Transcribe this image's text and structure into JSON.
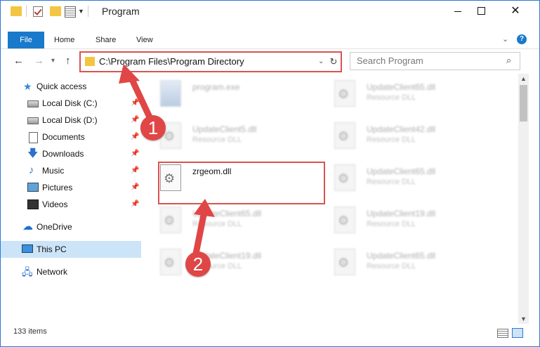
{
  "window": {
    "title": "Program",
    "controls": {
      "minimize": "",
      "maximize": "",
      "close": "✕"
    }
  },
  "ribbon": {
    "tabs": [
      "File",
      "Home",
      "Share",
      "View"
    ],
    "help": "?"
  },
  "address_bar": {
    "path": "C:\\Program Files\\Program Directory",
    "search_placeholder": "Search Program"
  },
  "sidebar": {
    "items": [
      {
        "label": "Quick access",
        "icon": "star-icon"
      },
      {
        "label": "Local Disk (C:)",
        "icon": "drive-icon",
        "pinned": true
      },
      {
        "label": "Local Disk (D:)",
        "icon": "drive-icon",
        "pinned": true
      },
      {
        "label": "Documents",
        "icon": "document-icon",
        "pinned": true
      },
      {
        "label": "Downloads",
        "icon": "download-icon",
        "pinned": true
      },
      {
        "label": "Music",
        "icon": "music-icon",
        "pinned": true
      },
      {
        "label": "Pictures",
        "icon": "pictures-icon",
        "pinned": true
      },
      {
        "label": "Videos",
        "icon": "videos-icon",
        "pinned": true
      },
      {
        "label": "OneDrive",
        "icon": "cloud-icon"
      },
      {
        "label": "This PC",
        "icon": "pc-icon",
        "selected": true
      },
      {
        "label": "Network",
        "icon": "network-icon"
      }
    ]
  },
  "files": [
    {
      "name": "program.exe",
      "type": ""
    },
    {
      "name": "UpdateClient65.dll",
      "type": "Resource DLL"
    },
    {
      "name": "UpdateClient5.dll",
      "type": "Resource DLL"
    },
    {
      "name": "UpdateClient42.dll",
      "type": "Resource DLL"
    },
    {
      "name": "zrgeom.dll",
      "type": ""
    },
    {
      "name": "UpdateClient65.dll",
      "type": "Resource DLL"
    },
    {
      "name": "UpdateClient65.dll",
      "type": "Resource DLL"
    },
    {
      "name": "UpdateClient19.dll",
      "type": "Resource DLL"
    },
    {
      "name": "UpdateClient19.dll",
      "type": "Resource DLL"
    },
    {
      "name": "UpdateClient65.dll",
      "type": "Resource DLL"
    }
  ],
  "annotations": {
    "marker1": "1",
    "marker2": "2"
  },
  "status": {
    "item_count": "133 items"
  },
  "colors": {
    "accent": "#1979ca",
    "highlight": "#d9534f",
    "selection": "#cce4f7"
  }
}
